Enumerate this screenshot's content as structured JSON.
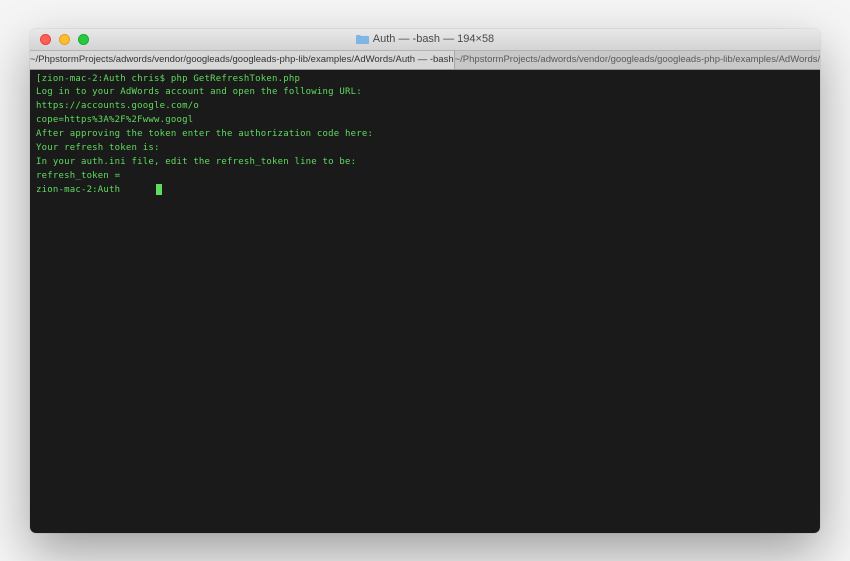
{
  "window": {
    "title": "Auth — -bash — 194×58",
    "folder_icon": "folder"
  },
  "tabs": {
    "items": [
      {
        "label": "~/PhpstormProjects/adwords/vendor/googleads/googleads-php-lib/examples/AdWords/Auth — -bash",
        "active": true
      },
      {
        "label": "~/PhpstormProjects/adwords/vendor/googleads/googleads-php-lib/examples/AdWords/Auth — -bash",
        "active": false
      }
    ],
    "add_icon": "+"
  },
  "terminal": {
    "lines": [
      "[zion-mac-2:Auth chris$ php GetRefreshToken.php",
      "Log in to your AdWords account and open the following URL:",
      "https://accounts.google.com/o",
      "cope=https%3A%2F%2Fwww.googl",
      "",
      "After approving the token enter the authorization code here:",
      "",
      "Your refresh token is:",
      "",
      "In your auth.ini file, edit the refresh_token line to be:",
      "refresh_token ="
    ],
    "prompt": "zion-mac-2:Auth"
  },
  "colors": {
    "terminal_bg": "#1a1a1a",
    "terminal_fg": "#5fdc5f"
  }
}
